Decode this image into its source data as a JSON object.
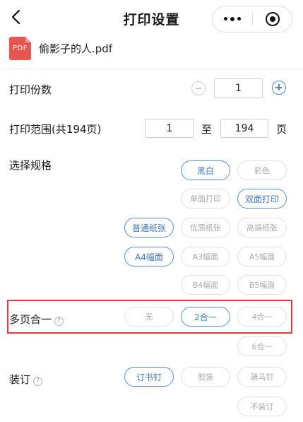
{
  "header": {
    "title": "打印设置"
  },
  "file": {
    "icon_text": "PDF",
    "name": "偷影子的人.pdf"
  },
  "copies": {
    "label": "打印份数",
    "value": "1"
  },
  "range": {
    "label": "打印范围(共194页)",
    "from": "1",
    "to_label": "至",
    "to": "194",
    "unit": "页"
  },
  "spec": {
    "label": "选择规格",
    "color_options": [
      "黑白",
      "彩色"
    ],
    "side_options": [
      "单面打印",
      "双面打印"
    ],
    "paper_options": [
      "普通纸张",
      "优质纸张",
      "高端纸张"
    ],
    "size_options": [
      "A4幅面",
      "A3幅面",
      "A5幅面",
      "B4幅面",
      "B5幅面"
    ]
  },
  "multipage": {
    "label": "多页合一",
    "help": "?",
    "options": [
      "无",
      "2合一",
      "4合一",
      "6合一"
    ]
  },
  "binding": {
    "label": "装订",
    "help": "?",
    "options": [
      "订书钉",
      "胶装",
      "骑马钉",
      "不装订"
    ]
  },
  "colors": {
    "accent": "#4a86c8",
    "highlight_border": "#e03a3a",
    "pdf_icon": "#e8554e"
  }
}
